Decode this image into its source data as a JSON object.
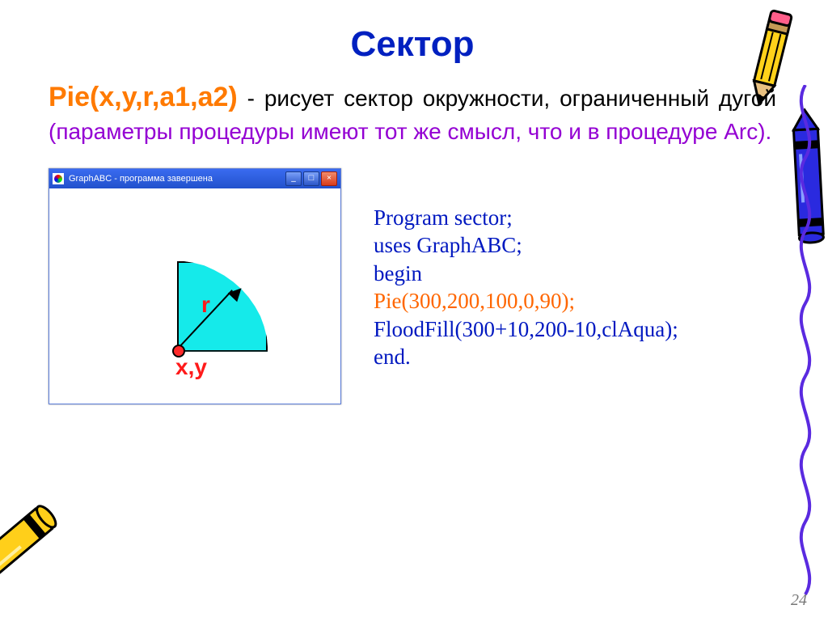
{
  "title": "Сектор",
  "func": "Pie(x,y,r,a1,a2)",
  "desc_black1": " - рисует сектор ",
  "desc_black2": "окружности, ограниченный дугой ",
  "desc_purple": "(параметры процедуры имеют тот же смысл, что и в процедуре Arc).",
  "window_title": "GraphABC - программа завершена",
  "label_r": "r",
  "label_xy": "x,y",
  "code": {
    "l1": "Program sector;",
    "l2": "uses GraphABC;",
    "l3": "begin",
    "l4": "Pie(300,200,100,0,90);",
    "l5": "FloodFill(300+10,200-10,clAqua);",
    "l6": "end."
  },
  "page_number": "24",
  "win_min": "_",
  "win_max": "□",
  "win_close": "×"
}
